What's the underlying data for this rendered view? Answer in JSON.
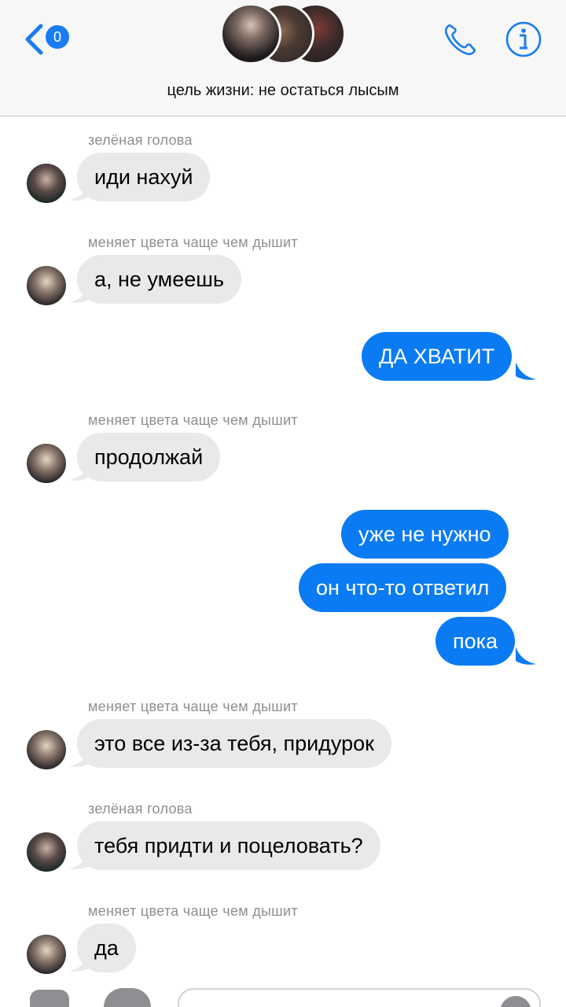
{
  "header": {
    "back_badge": "0",
    "group_name": "цель жизни: не остаться лысым",
    "accent": "#1a7cf0"
  },
  "messages": [
    {
      "dir": "in",
      "sender": "зелёная голова",
      "avatar": "green",
      "text": "иди нахуй"
    },
    {
      "dir": "in",
      "sender": "меняет цвета чаще чем дышит",
      "avatar": "blond",
      "text": "а, не умеешь"
    },
    {
      "dir": "out",
      "text": "ДА ХВАТИТ"
    },
    {
      "dir": "in",
      "sender": "меняет цвета чаще чем дышит",
      "avatar": "blond",
      "text": "продолжай"
    },
    {
      "dir": "out",
      "text": "уже не нужно"
    },
    {
      "dir": "out",
      "text": "он что-то ответил"
    },
    {
      "dir": "out",
      "text": "пока"
    },
    {
      "dir": "in",
      "sender": "меняет цвета чаще чем дышит",
      "avatar": "blond",
      "text": "это все из-за тебя, придурок"
    },
    {
      "dir": "in",
      "sender": "зелёная голова",
      "avatar": "green",
      "text": "тебя придти и поцеловать?"
    },
    {
      "dir": "in",
      "sender": "меняет цвета чаще чем дышит",
      "avatar": "blond",
      "text": "да"
    }
  ],
  "colors": {
    "incoming_bubble": "#e9e9eb",
    "outgoing_bubble": "#0b7bf3",
    "sender_label": "#8e8e93"
  },
  "icons": [
    "chevron-left-icon",
    "phone-icon",
    "info-icon",
    "camera-icon",
    "app-store-icon",
    "microphone-icon"
  ]
}
